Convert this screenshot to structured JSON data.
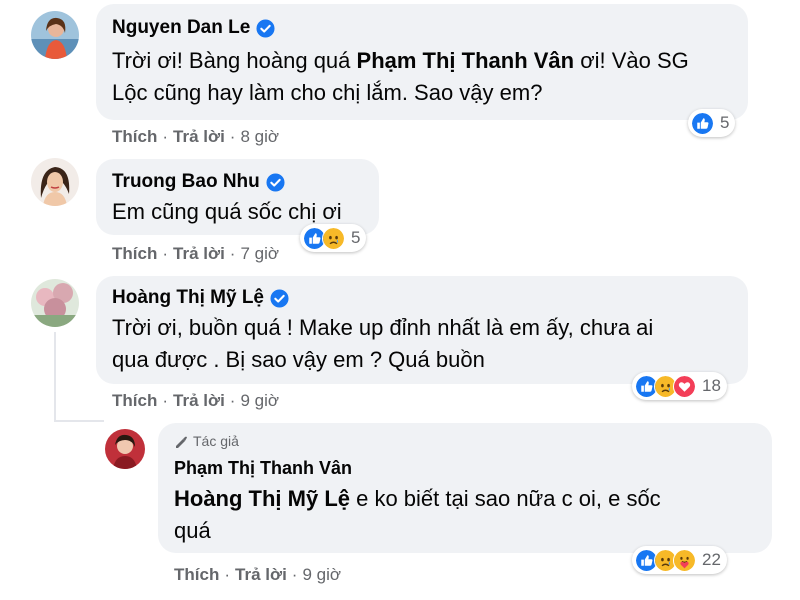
{
  "comments": [
    {
      "name": "Nguyen Dan Le",
      "text_line1_a": "Trời ơi! Bàng hoàng quá ",
      "text_line1_mention": "Phạm Thị Thanh Vân",
      "text_line1_b": " ơi! Vào SG",
      "text_line2": "Lộc cũng hay làm cho chị lắm. Sao vậy em?",
      "like": "Thích",
      "reply": "Trả lời",
      "time": "8 giờ",
      "reaction_count": "5",
      "reactions": [
        "like-reaction"
      ]
    },
    {
      "name": "Truong Bao Nhu",
      "text_line1": "Em cũng quá sốc chị ơi",
      "like": "Thích",
      "reply": "Trả lời",
      "time": "7 giờ",
      "reaction_count": "5",
      "reactions": [
        "like-reaction",
        "sad-reaction"
      ]
    },
    {
      "name": "Hoàng Thị Mỹ Lệ",
      "text_line1": "Trời ơi, buồn quá ! Make up đỉnh nhất là em ấy, chưa ai",
      "text_line2": "qua được . Bị sao vậy em ? Quá buồn",
      "like": "Thích",
      "reply": "Trả lời",
      "time": "9 giờ",
      "reaction_count": "18",
      "reactions": [
        "like-reaction",
        "sad-reaction",
        "love-reaction"
      ]
    },
    {
      "author_tag": "Tác giả",
      "name": "Phạm Thị Thanh Vân",
      "text_line1_mention": "Hoàng Thị Mỹ Lệ",
      "text_line1_b": " e ko biết tại sao nữa c oi, e sốc",
      "text_line2": "quá",
      "like": "Thích",
      "reply": "Trả lời",
      "time": "9 giờ",
      "reaction_count": "22",
      "reactions": [
        "like-reaction",
        "sad-reaction",
        "care-reaction"
      ]
    }
  ],
  "separator": "·",
  "colors": {
    "bubble": "#f0f2f5",
    "text": "#050505",
    "meta": "#65676b",
    "facebook_blue": "#1877f2",
    "sad_yellow": "#f7b928",
    "love_red": "#f33e58"
  }
}
